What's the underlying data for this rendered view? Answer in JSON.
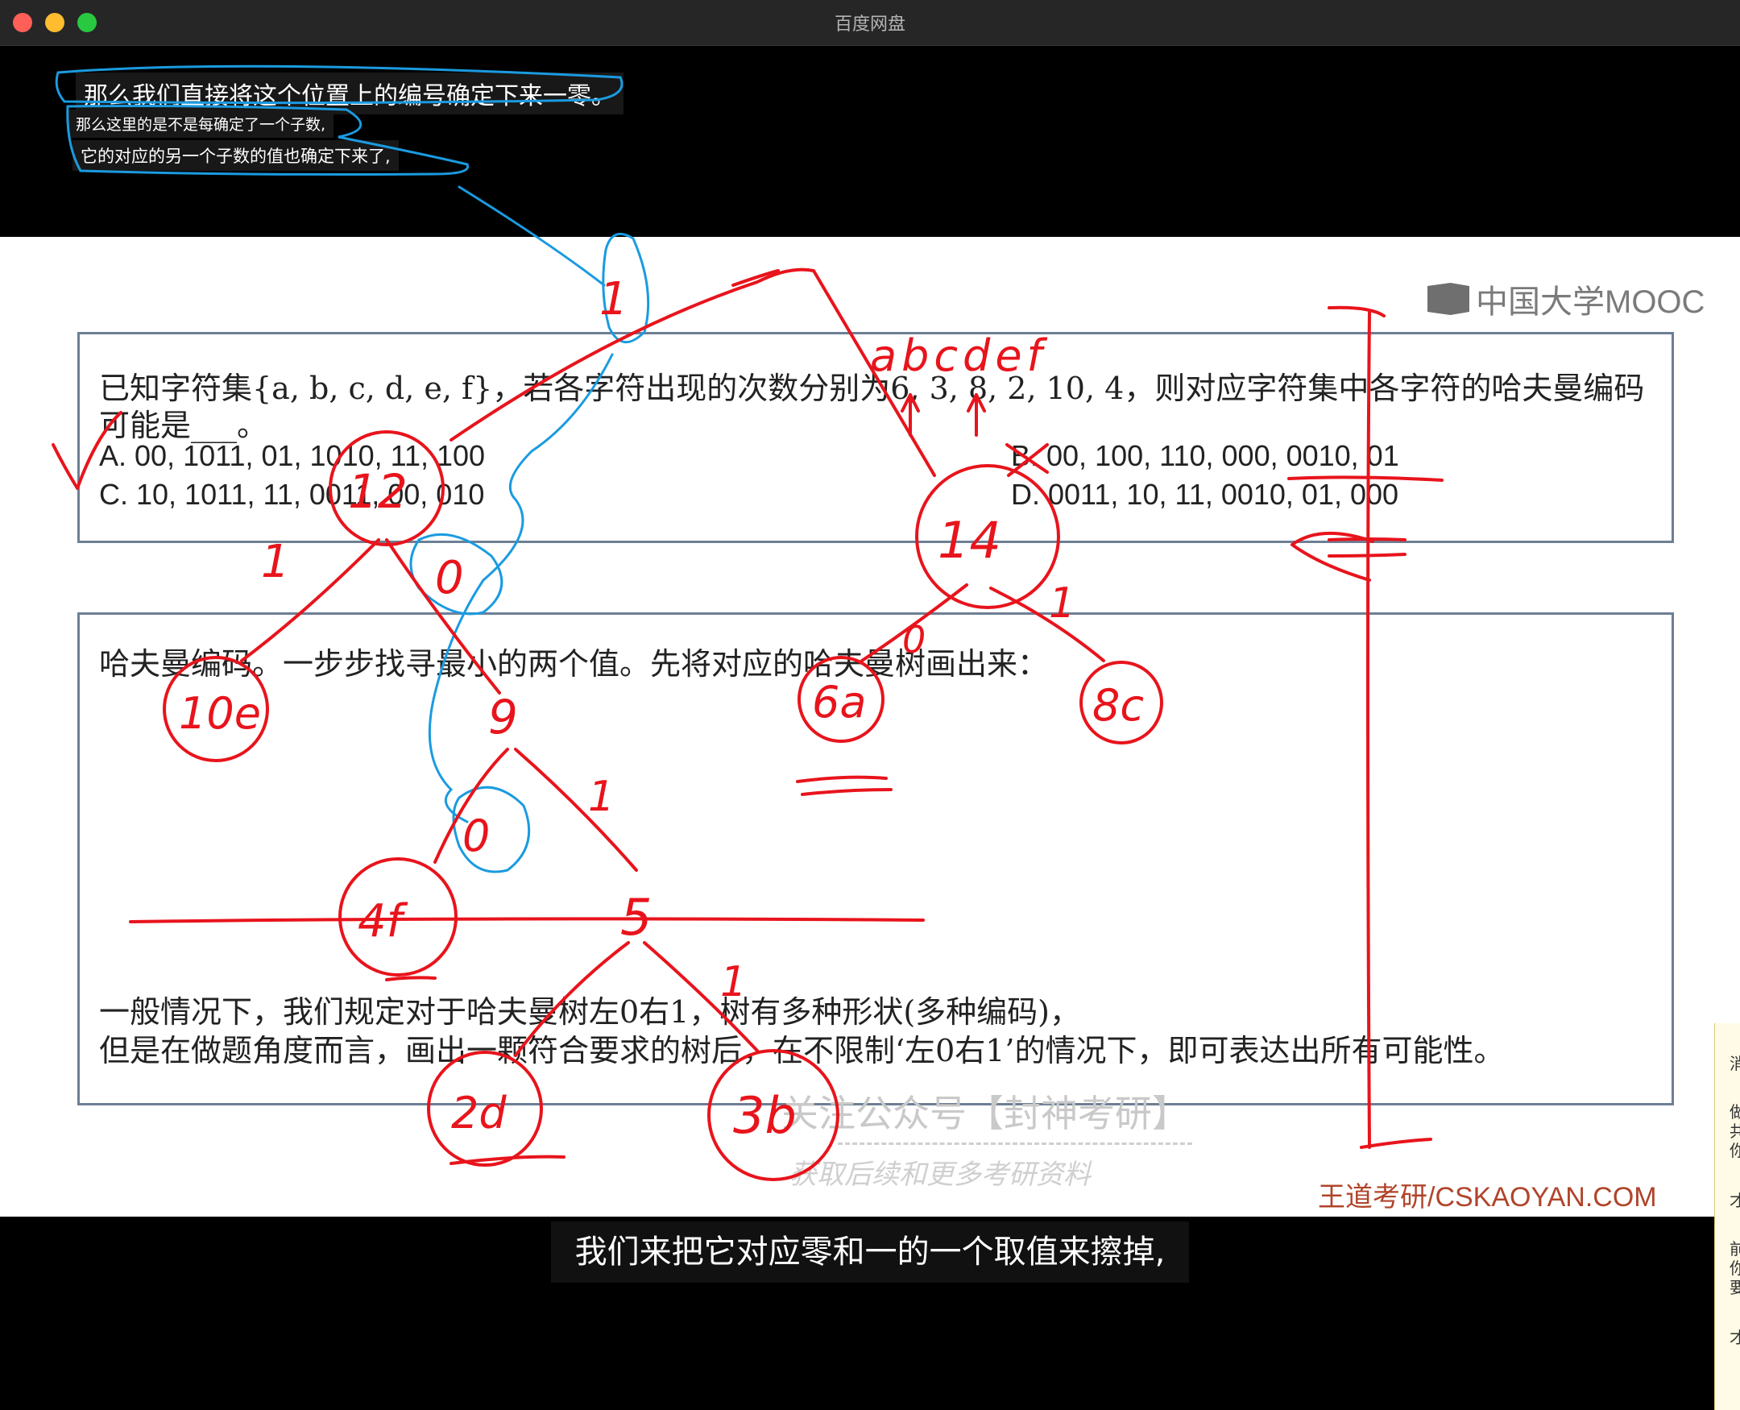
{
  "window": {
    "title": "百度网盘"
  },
  "subtitles_top": [
    "那么我们直接将这个位置上的编号确定下来一零。",
    "那么这里的是不是每确定了一个子数,",
    "它的对应的另一个子数的值也确定下来了,"
  ],
  "slide": {
    "logo": "中国大学MOOC",
    "question": {
      "line1": "已知字符集{a, b, c, d, e, f}，若各字符出现的次数分别为6, 3, 8, 2, 10, 4，则对应字符集中各字符的哈夫曼编码",
      "line2": "可能是___。",
      "option_a": "A. 00, 1011, 01, 1010, 11, 100",
      "option_b": "B. 00, 100, 110, 000, 0010, 01",
      "option_c": "C. 10, 1011, 11, 0011, 00, 010",
      "option_d": "D. 0011, 10, 11, 0010, 01, 000"
    },
    "answer": {
      "line1": "哈夫曼编码。一步步找寻最小的两个值。先将对应的哈夫曼树画出来：",
      "line2": "一般情况下，我们规定对于哈夫曼树左0右1，树有多种形状(多种编码)，",
      "line3": "但是在做题角度而言，画出一颗符合要求的树后，在不限制‘左0右1’的情况下，即可表达出所有可能性。"
    },
    "watermark": "关注公众号【封神考研】",
    "watermark_sub": "获取后续和更多考研资料",
    "brand": "王道考研/CSKAOYAN.COM"
  },
  "caption": "我们来把它对应零和一的一个取值来擦掉,",
  "side_panel_chars": [
    "消",
    "",
    "做",
    "共",
    "你",
    "",
    "才",
    "",
    "前",
    "你",
    "要",
    "",
    "才"
  ],
  "annotations": {
    "letters": "abcdef",
    "nodes": [
      "1",
      "12",
      "0",
      "14",
      "10e",
      "9",
      "6a",
      "8c",
      "0",
      "4f",
      "5",
      "2d",
      "3b",
      "0",
      "1",
      "1",
      "1",
      "1"
    ]
  },
  "colors": {
    "ink_red": "#e8141c",
    "ink_blue": "#1a9be0",
    "titlebar": "#262626"
  }
}
